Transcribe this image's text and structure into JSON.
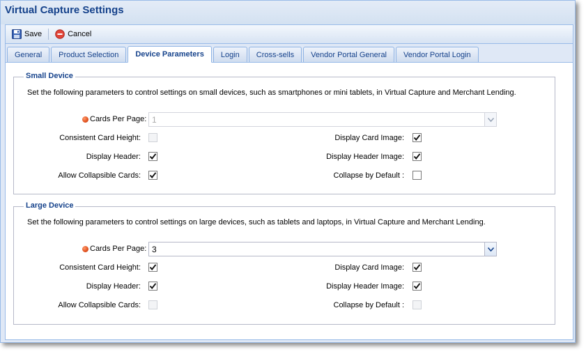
{
  "window": {
    "title": "Virtual Capture Settings"
  },
  "toolbar": {
    "save_label": "Save",
    "cancel_label": "Cancel"
  },
  "tabs": [
    {
      "label": "General",
      "active": false
    },
    {
      "label": "Product Selection",
      "active": false
    },
    {
      "label": "Device Parameters",
      "active": true
    },
    {
      "label": "Login",
      "active": false
    },
    {
      "label": "Cross-sells",
      "active": false
    },
    {
      "label": "Vendor Portal General",
      "active": false
    },
    {
      "label": "Vendor Portal Login",
      "active": false
    }
  ],
  "small_device": {
    "legend": "Small Device",
    "description": "Set the following parameters to control settings on small devices, such as smartphones or mini tablets, in Virtual Capture and Merchant Lending.",
    "cards_per_page_label": "Cards Per Page:",
    "cards_per_page_value": "1",
    "consistent_card_height_label": "Consistent Card Height:",
    "display_header_label": "Display Header:",
    "allow_collapsible_cards_label": "Allow Collapsible Cards:",
    "display_card_image_label": "Display Card Image:",
    "display_header_image_label": "Display Header Image:",
    "collapse_by_default_label": "Collapse by Default :",
    "consistent_card_height": {
      "checked": false,
      "disabled": true
    },
    "display_header": {
      "checked": true,
      "disabled": false
    },
    "allow_collapsible_cards": {
      "checked": true,
      "disabled": false
    },
    "display_card_image": {
      "checked": true,
      "disabled": false
    },
    "display_header_image": {
      "checked": true,
      "disabled": false
    },
    "collapse_by_default": {
      "checked": false,
      "disabled": false
    }
  },
  "large_device": {
    "legend": "Large Device",
    "description": "Set the following parameters to control settings on large devices, such as tablets and laptops, in Virtual Capture and Merchant Lending.",
    "cards_per_page_label": "Cards Per Page:",
    "cards_per_page_value": "3",
    "consistent_card_height_label": "Consistent Card Height:",
    "display_header_label": "Display Header:",
    "allow_collapsible_cards_label": "Allow Collapsible Cards:",
    "display_card_image_label": "Display Card Image:",
    "display_header_image_label": "Display Header Image:",
    "collapse_by_default_label": "Collapse by Default :",
    "consistent_card_height": {
      "checked": true,
      "disabled": false
    },
    "display_header": {
      "checked": true,
      "disabled": false
    },
    "allow_collapsible_cards": {
      "checked": false,
      "disabled": true
    },
    "display_card_image": {
      "checked": true,
      "disabled": false
    },
    "display_header_image": {
      "checked": true,
      "disabled": false
    },
    "collapse_by_default": {
      "checked": false,
      "disabled": true
    }
  },
  "colors": {
    "title": "#15428b",
    "panel_bg": "#dfe8f6",
    "border": "#99bbe8",
    "required_dot": "#e0501e"
  },
  "icons": {
    "save": "floppy-disk-icon",
    "cancel": "cancel-circle-icon",
    "required": "required-dot-icon",
    "dropdown": "chevron-down-icon",
    "check": "check-icon"
  }
}
